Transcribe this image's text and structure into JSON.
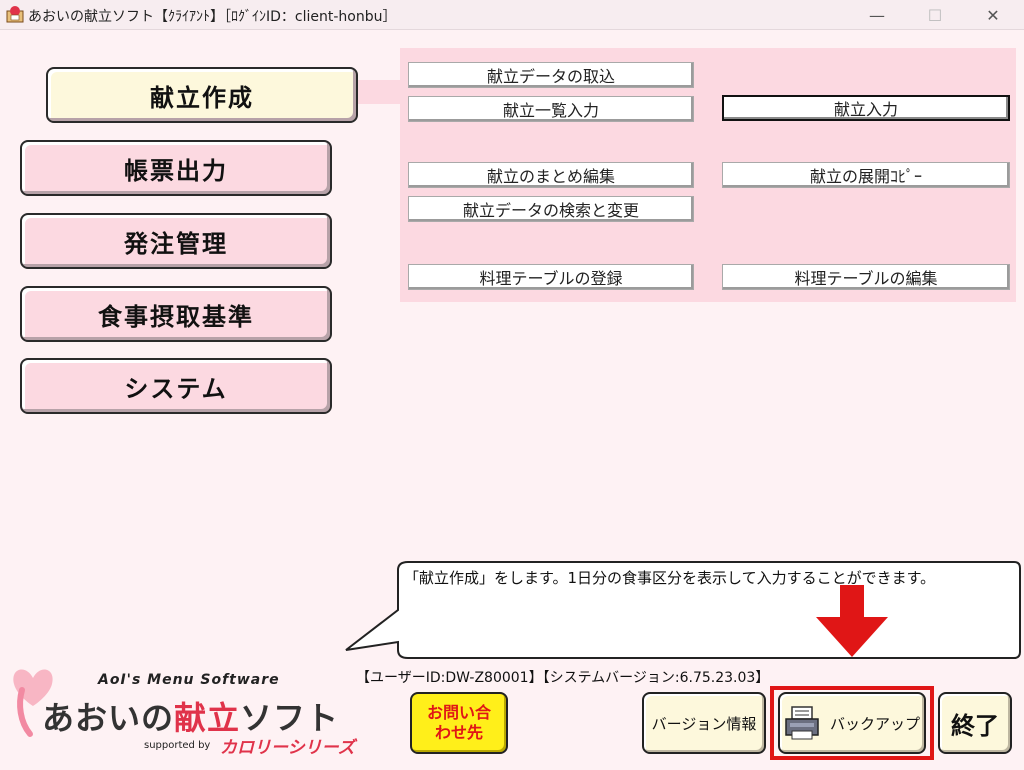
{
  "window": {
    "title": "あおいの献立ソフト【ｸﾗｲｱﾝﾄ】［ﾛｸﾞｲﾝID：client-honbu］",
    "controls": [
      "—",
      "☐",
      "✕"
    ]
  },
  "categories": [
    {
      "label": "献立作成",
      "active": true
    },
    {
      "label": "帳票出力",
      "active": false
    },
    {
      "label": "発注管理",
      "active": false
    },
    {
      "label": "食事摂取基準",
      "active": false
    },
    {
      "label": "システム",
      "active": false
    }
  ],
  "submenu": {
    "import_data": "献立データの取込",
    "list_input": "献立一覧入力",
    "menu_input": "献立入力",
    "bulk_edit": "献立のまとめ編集",
    "expand_copy": "献立の展開ｺﾋﾟｰ",
    "search_change": "献立データの検索と変更",
    "register_table": "料理テーブルの登録",
    "edit_table": "料理テーブルの編集"
  },
  "message": "「献立作成」をします。1日分の食事区分を表示して入力することができます。",
  "status": "【ユーザーID:DW-Z80001】【システムバージョン:6.75.23.03】",
  "logo": {
    "english": "AoI's Menu Software",
    "japanese_part1": "あおいの",
    "japanese_part2": "献立",
    "japanese_part3": "ソフト",
    "supported_by": "supported by",
    "series": "カロリーシリーズ"
  },
  "buttons": {
    "inquiry_line1": "お問い合",
    "inquiry_line2": "わせ先",
    "version_info": "バージョン情報",
    "backup": "バックアップ",
    "exit": "終了"
  },
  "colors": {
    "background": "#fef2f4",
    "pink_panel": "#fcd9e1",
    "cream": "#fdf8dc",
    "highlight_red": "#e01616",
    "inquiry_yellow": "#ffef1a"
  },
  "icons": [
    "app-icon",
    "minimize-icon",
    "maximize-icon",
    "close-icon",
    "backup-printer-icon",
    "down-arrow-icon",
    "heart-logo-icon"
  ]
}
